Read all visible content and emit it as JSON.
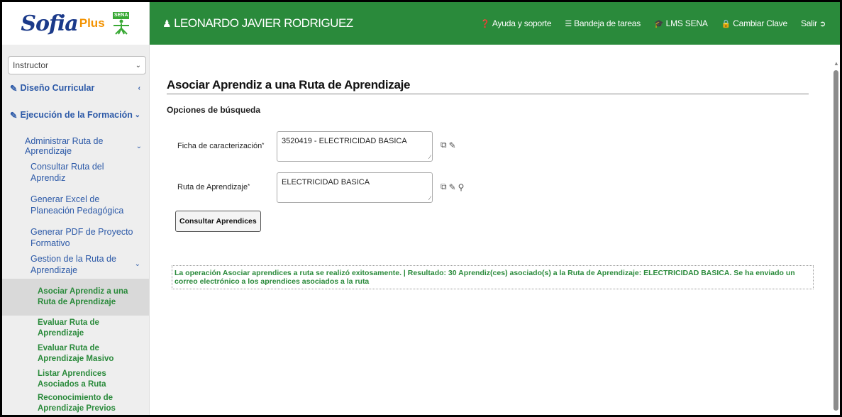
{
  "header": {
    "logo_text": "Sofia",
    "logo_plus": "Plus",
    "sena_text": "SENA",
    "user_name": "LEONARDO JAVIER RODRIGUEZ",
    "links": [
      {
        "label": "Ayuda y soporte",
        "icon": "question-circle-icon"
      },
      {
        "label": "Bandeja de tareas",
        "icon": "list-icon"
      },
      {
        "label": "LMS SENA",
        "icon": "graduation-cap-icon"
      },
      {
        "label": "Cambiar Clave",
        "icon": "lock-icon"
      },
      {
        "label": "Salir",
        "icon": "sign-out-icon"
      }
    ]
  },
  "sidebar": {
    "role": "Instructor",
    "sections": [
      {
        "label": "Diseño Curricular"
      },
      {
        "label": "Ejecución de la Formación"
      }
    ],
    "sub": "Administrar Ruta de Aprendizaje",
    "items": [
      "Consultar Ruta del Aprendiz",
      "Generar Excel de Planeación Pedagógica",
      "Generar PDF de Proyecto Formativo",
      "Gestion de la Ruta de Aprendizaje"
    ],
    "leaves": [
      "Asociar Aprendiz a una Ruta de Aprendizaje",
      "Evaluar Ruta de Aprendizaje",
      "Evaluar Ruta de Aprendizaje Masivo",
      "Listar Aprendices Asociados a Ruta",
      "Reconocimiento de Aprendizaje Previos Masivo"
    ]
  },
  "main": {
    "title": "Asociar Aprendiz a una Ruta de Aprendizaje",
    "options_title": "Opciones de búsqueda",
    "ficha_label": "Ficha de caracterización",
    "ficha_value": "3520419 - ELECTRICIDAD BASICA",
    "ruta_label": "Ruta de Aprendizaje",
    "ruta_value": "ELECTRICIDAD BASICA",
    "required_mark": "*",
    "consult_button": "Consultar Aprendices",
    "success_message": "La operación Asociar aprendices a ruta se realizó exitosamente. | Resultado: 30 Aprendiz(ces) asociado(s) a la Ruta de Aprendizaje: ELECTRICIDAD BASICA. Se ha enviado un correo electrónico a los aprendices asociados a la ruta"
  },
  "colors": {
    "header_green": "#2a8a3b",
    "link_blue": "#2d5aa8",
    "leaf_green": "#2a8a3b"
  }
}
